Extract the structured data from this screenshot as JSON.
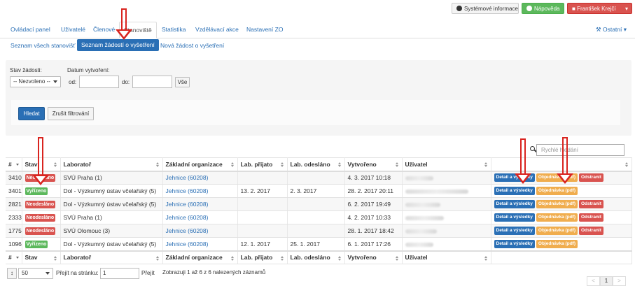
{
  "top_buttons": {
    "system_info": "Systémové informace",
    "help": "Nápověda",
    "user": "František Krejčí"
  },
  "nav": {
    "tabs": [
      "Ovládací panel",
      "Uživatelé",
      "Členové",
      "Stanoviště",
      "Statistika",
      "Vzdělávací akce",
      "Nastavení ZO"
    ],
    "active_tab": "Stanoviště",
    "other": "Ostatní"
  },
  "subnav": {
    "items": [
      "Seznam všech stanovišť",
      "Seznam žádostí o vyšetření",
      "Nová žádost o vyšetření"
    ],
    "active": "Seznam žádostí o vyšetření"
  },
  "filter": {
    "status_label": "Stav žádosti:",
    "status_value": "-- Nezvoleno --",
    "created_label": "Datum vytvoření:",
    "from_label": "od:",
    "to_label": "do:",
    "all_button": "Vše",
    "search_button": "Hledat",
    "cancel_button": "Zrušit filtrování"
  },
  "quick_search_placeholder": "Rychlé hledání",
  "table": {
    "columns": [
      "#",
      "Stav",
      "Laboratoř",
      "Základní organizace",
      "Lab. přijato",
      "Lab. odesláno",
      "Vytvořeno",
      "Uživatel",
      ""
    ],
    "actions": {
      "detail": "Detail a výsledky",
      "order": "Objednávka (pdf)",
      "remove": "Odstranit"
    },
    "rows": [
      {
        "id": "3410",
        "status": "Neodesláno",
        "status_color": "#d9534f",
        "lab": "SVÚ Praha (1)",
        "org": "Jehnice (60208)",
        "received": "",
        "sent": "",
        "created": "4. 3. 2017 10:18",
        "has_remove": true
      },
      {
        "id": "3401",
        "status": "Vyřízeno",
        "status_color": "#5cb85c",
        "lab": "Dol - Výzkumný ústav včelařský (5)",
        "org": "Jehnice (60208)",
        "received": "13. 2. 2017",
        "sent": "2. 3. 2017",
        "created": "28. 2. 2017 20:11",
        "has_remove": false
      },
      {
        "id": "2821",
        "status": "Neodesláno",
        "status_color": "#d9534f",
        "lab": "Dol - Výzkumný ústav včelařský (5)",
        "org": "Jehnice (60208)",
        "received": "",
        "sent": "",
        "created": "6. 2. 2017 19:49",
        "has_remove": true
      },
      {
        "id": "2333",
        "status": "Neodesláno",
        "status_color": "#d9534f",
        "lab": "SVÚ Praha (1)",
        "org": "Jehnice (60208)",
        "received": "",
        "sent": "",
        "created": "4. 2. 2017 10:33",
        "has_remove": true
      },
      {
        "id": "1775",
        "status": "Neodesláno",
        "status_color": "#d9534f",
        "lab": "SVÚ Olomouc (3)",
        "org": "Jehnice (60208)",
        "received": "",
        "sent": "",
        "created": "28. 1. 2017 18:42",
        "has_remove": true
      },
      {
        "id": "1096",
        "status": "Vyřízeno",
        "status_color": "#5cb85c",
        "lab": "Dol - Výzkumný ústav včelařský (5)",
        "org": "Jehnice (60208)",
        "received": "12. 1. 2017",
        "sent": "25. 1. 2017",
        "created": "6. 1. 2017 17:26",
        "has_remove": false
      }
    ]
  },
  "footer": {
    "page_size": "50",
    "goto_label": "Přejít na stránku:",
    "goto_value": "1",
    "goto_button": "Přejít",
    "info": "Zobrazuji 1 až 6 z 6 nalezených záznamů",
    "prev": "<",
    "page": "1",
    "next": ">"
  }
}
